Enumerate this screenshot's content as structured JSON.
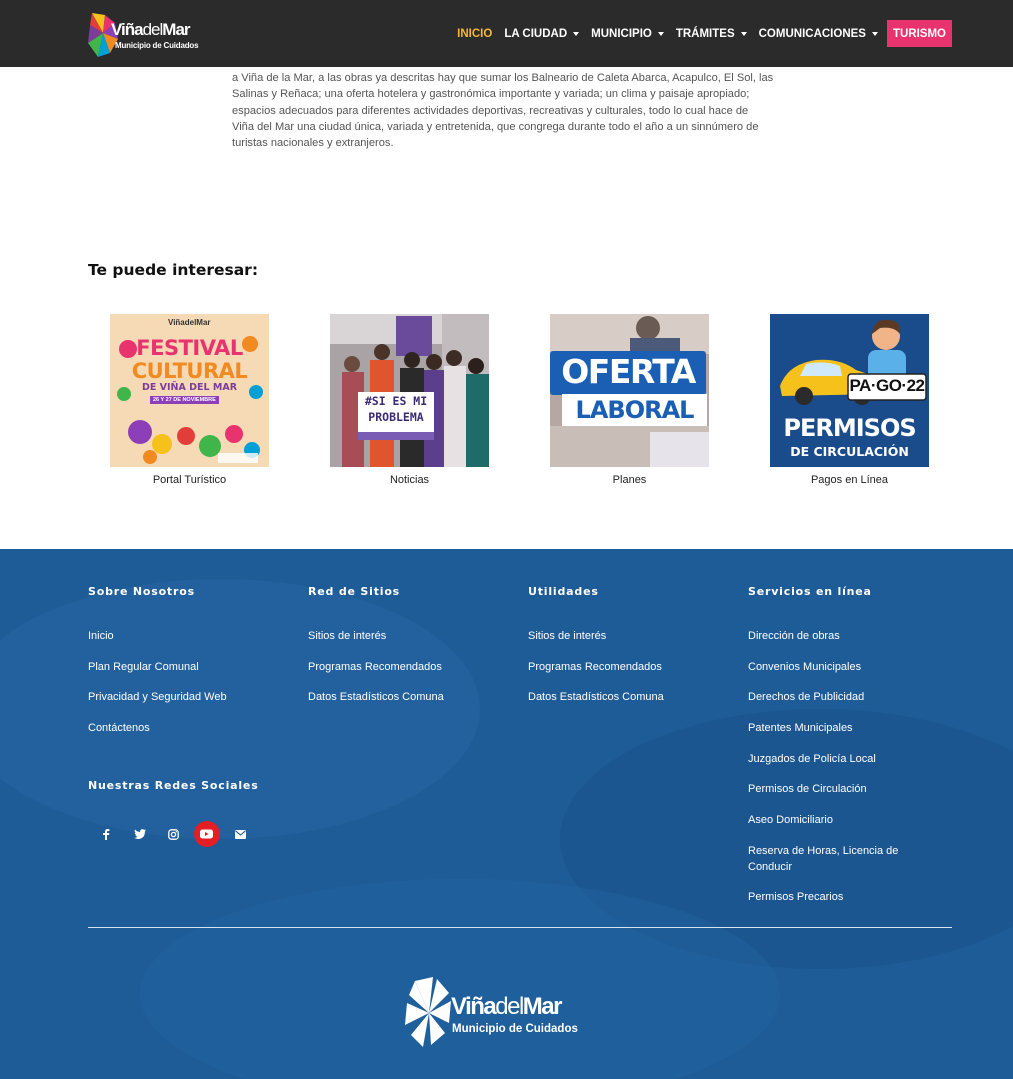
{
  "header": {
    "logo": {
      "word_main": "Viña",
      "word_thin": "del",
      "word_end": "Mar",
      "subtitle": "Municipio de Cuidados"
    },
    "nav": [
      {
        "label": "INICIO",
        "active": true,
        "dropdown": false
      },
      {
        "label": "LA CIUDAD",
        "active": false,
        "dropdown": true
      },
      {
        "label": "MUNICIPIO",
        "active": false,
        "dropdown": true
      },
      {
        "label": "TRÁMITES",
        "active": false,
        "dropdown": true
      },
      {
        "label": "COMUNICACIONES",
        "active": false,
        "dropdown": true
      }
    ],
    "turismo_label": "TURISMO",
    "colors": {
      "bar": "#2b2b2b",
      "active": "#f4b834",
      "turismo": "#e8336e"
    }
  },
  "intro": {
    "lines": [
      "a Viña de la Mar, a las obras ya descritas hay que sumar los Balneario de Caleta Abarca, Acapulco, El Sol, las",
      "Salinas y Reñaca; una oferta hotelera y gastronómica importante y variada; un clima y paisaje apropiado;",
      "espacios adecuados para diferentes actividades deportivas, recreativas y culturales, todo lo cual hace de",
      "Viña del Mar una ciudad única, variada y entretenida, que congrega durante todo el año a un sinnúmero de",
      "turistas nacionales y extranjeros."
    ]
  },
  "interest": {
    "title": "Te puede interesar:",
    "cards": [
      {
        "caption": "Portal Turístico",
        "image": {
          "logo_word": "ViñadelMar",
          "line1": "FESTIVAL",
          "line2": "CULTURAL",
          "line3": "DE VIÑA DEL MAR",
          "date": "26 Y 27 DE NOVIEMBRE"
        }
      },
      {
        "caption": "Noticias",
        "image": {
          "sign_line1": "#SI ES MI",
          "sign_line2": "PROBLEMA"
        }
      },
      {
        "caption": "Planes",
        "image": {
          "line1": "OFERTA",
          "line2": "LABORAL"
        }
      },
      {
        "caption": "Pagos en Línea",
        "image": {
          "plate": "PA·GO·22",
          "line1": "PERMISOS",
          "line2": "DE CIRCULACIÓN"
        }
      }
    ]
  },
  "footer": {
    "about": {
      "title": "Sobre Nosotros",
      "links": [
        "Inicio",
        "Plan Regular Comunal",
        "Privacidad y Seguridad Web",
        "Contáctenos"
      ]
    },
    "sites": {
      "title": "Red de Sitios",
      "links": [
        "Sitios de interés",
        "Programas Recomendados",
        "Datos Estadísticos Comuna"
      ]
    },
    "utils": {
      "title": "Utilidades",
      "links": [
        "Sitios de interés",
        "Programas Recomendados",
        "Datos Estadísticos Comuna"
      ]
    },
    "services": {
      "title": "Servicios en línea",
      "links": [
        "Dirección de obras",
        "Convenios Municipales",
        "Derechos de Publicidad",
        "Patentes Municipales",
        "Juzgados de Policía Local",
        "Permisos de Circulación",
        "Aseo Domiciliario",
        "Reserva de Horas, Licencia de Conducir",
        "Permisos Precarios"
      ]
    },
    "social": {
      "title": "Nuestras Redes Sociales",
      "icons": [
        "facebook-icon",
        "twitter-icon",
        "instagram-icon",
        "youtube-icon",
        "email-icon"
      ]
    },
    "logo": {
      "word_main": "Viña",
      "word_thin": "del",
      "word_end": "Mar",
      "subtitle": "Municipio de Cuidados"
    },
    "colors": {
      "background": "#1e5c98",
      "youtube": "#e31e24"
    }
  }
}
